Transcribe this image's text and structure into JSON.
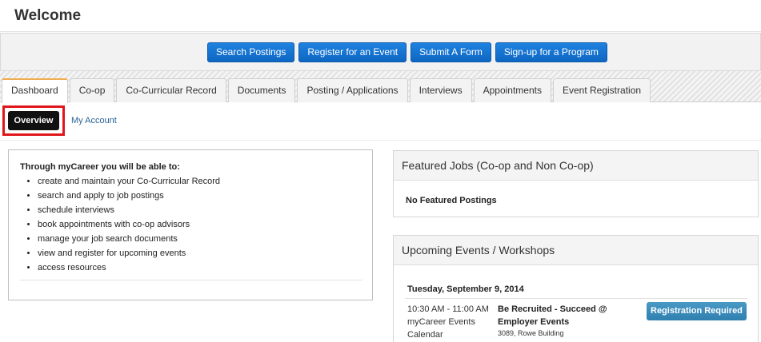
{
  "page": {
    "title": "Welcome"
  },
  "actions": [
    {
      "label": "Search Postings"
    },
    {
      "label": "Register for an Event"
    },
    {
      "label": "Submit A Form"
    },
    {
      "label": "Sign-up for a Program"
    }
  ],
  "tabs": [
    {
      "label": "Dashboard",
      "active": true
    },
    {
      "label": "Co-op"
    },
    {
      "label": "Co-Curricular Record"
    },
    {
      "label": "Documents"
    },
    {
      "label": "Posting / Applications"
    },
    {
      "label": "Interviews"
    },
    {
      "label": "Appointments"
    },
    {
      "label": "Event Registration"
    }
  ],
  "subnav": {
    "overview": "Overview",
    "my_account": "My Account"
  },
  "intro": {
    "heading": "Through myCareer you will be able to:",
    "items": [
      "create and maintain your Co-Curricular Record",
      "search and apply to job postings",
      "schedule interviews",
      "book appointments with co-op advisors",
      "manage your job search documents",
      "view and register for upcoming events",
      "access resources"
    ]
  },
  "featured": {
    "title": "Featured Jobs (Co-op and Non Co-op)",
    "empty_text": "No Featured Postings"
  },
  "events": {
    "title": "Upcoming Events / Workshops",
    "date": "Tuesday, September 9, 2014",
    "items": [
      {
        "time": "10:30 AM - 11:00 AM",
        "calendar": "myCareer Events Calendar",
        "title": "Be Recruited - Succeed @ Employer Events",
        "location": "3089, Rowe Building",
        "badge": "Registration Required"
      }
    ]
  },
  "colors": {
    "accent_blue": "#1373d0",
    "tab_active_border": "#f0ad4e",
    "highlight_red": "#e0161b",
    "badge_blue": "#3c8dbc"
  }
}
